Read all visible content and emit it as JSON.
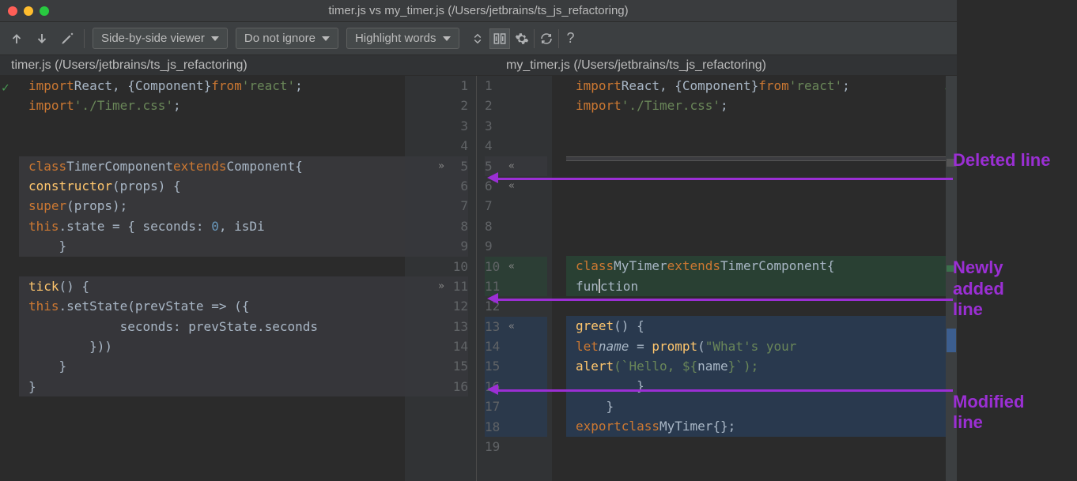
{
  "titlebar": {
    "title": "timer.js vs my_timer.js (/Users/jetbrains/ts_js_refactoring)"
  },
  "toolbar": {
    "viewer_dropdown": "Side-by-side viewer",
    "ignore_dropdown": "Do not ignore",
    "highlight_dropdown": "Highlight words"
  },
  "headers": {
    "left": "timer.js (/Users/jetbrains/ts_js_refactoring)",
    "right": "my_timer.js (/Users/jetbrains/ts_js_refactoring)"
  },
  "annotations": {
    "deleted": "Deleted line",
    "added": "Newly added line",
    "modified": "Modified line"
  },
  "left_code": {
    "l1_import": "import",
    "l1_react": "React",
    "l1_comp": "{Component}",
    "l1_from": "from",
    "l1_str": "'react'",
    "l1_semi": ";",
    "l2_import": "import",
    "l2_str": "'./Timer.css'",
    "l2_semi": ";",
    "l5_class": "class",
    "l5_name": "TimerComponent",
    "l5_ext": "extends",
    "l5_par": "Component",
    "l5_brace": "{",
    "l6": "    constructor(props) {",
    "l6_ctor": "constructor",
    "l6_p": "(props) {",
    "l7_super": "super",
    "l7_args": "(props);",
    "l8_this": "this",
    "l8_state": ".state = { seconds: ",
    "l8_zero": "0",
    "l8_rest": ", isDi",
    "l9": "    }",
    "l11_tick": "tick",
    "l11_rest": "() {",
    "l12_this": "this",
    "l12_set": ".setState(prevState => ({",
    "l13": "            seconds: prevState.seconds",
    "l14": "        }))",
    "l15": "    }",
    "l16": "}"
  },
  "right_code": {
    "r1_import": "import",
    "r1_react": "React",
    "r1_comp": "{Component}",
    "r1_from": "from",
    "r1_str": "'react'",
    "r1_semi": ";",
    "r2_import": "import",
    "r2_str": "'./Timer.css'",
    "r2_semi": ";",
    "r10_class": "class",
    "r10_name": "MyTimer",
    "r10_ext": "extends",
    "r10_par": "TimerComponent",
    "r10_brace": "{",
    "r11_fn_pre": "fun",
    "r11_fn_post": "ction",
    "r13_greet": "greet",
    "r13_rest": "() {",
    "r14_let": "let",
    "r14_name": "name",
    "r14_eq": " = ",
    "r14_prompt": "prompt",
    "r14_args": "(",
    "r14_str": "\"What's your ",
    "r15_alert": "alert",
    "r15_temp": "(`Hello, ${",
    "r15_nm": "name",
    "r15_end": "}`);",
    "r16": "        }",
    "r17": "    }",
    "r18_exp": "export",
    "r18_class": "class",
    "r18_name": "MyTimer",
    "r18_rest": "{};"
  },
  "line_numbers": {
    "left": [
      "1",
      "2",
      "3",
      "4",
      "5",
      "6",
      "7",
      "8",
      "9",
      "10",
      "11",
      "12",
      "13",
      "14",
      "15",
      "16"
    ],
    "right": [
      "1",
      "2",
      "3",
      "4",
      "5",
      "6",
      "7",
      "8",
      "9",
      "10",
      "11",
      "12",
      "13",
      "14",
      "15",
      "16",
      "17",
      "18",
      "19"
    ]
  },
  "arrows": {
    "right": "»",
    "left": "«"
  }
}
